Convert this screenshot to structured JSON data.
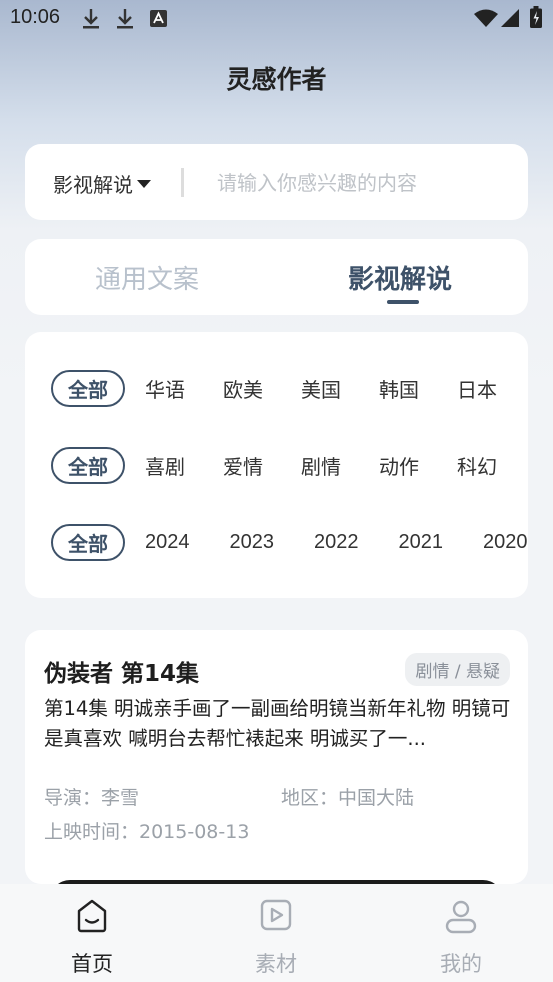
{
  "status_bar": {
    "time": "10:06"
  },
  "header": {
    "title": "灵感作者"
  },
  "search": {
    "category": "影视解说",
    "placeholder": "请输入你感兴趣的内容",
    "value": ""
  },
  "tabs": [
    {
      "label": "通用文案",
      "active": false
    },
    {
      "label": "影视解说",
      "active": true
    }
  ],
  "filters": {
    "regions": {
      "all_label": "全部",
      "options": [
        "华语",
        "欧美",
        "美国",
        "韩国",
        "日本"
      ]
    },
    "genres": {
      "all_label": "全部",
      "options": [
        "喜剧",
        "爱情",
        "剧情",
        "动作",
        "科幻"
      ]
    },
    "years": {
      "all_label": "全部",
      "options": [
        "2024",
        "2023",
        "2022",
        "2021",
        "2020"
      ]
    }
  },
  "item": {
    "title": "伪装者 第14集",
    "genre": "剧情 / 悬疑",
    "description": "第14集 明诚亲手画了一副画给明镜当新年礼物 明镜可是真喜欢 喊明台去帮忙裱起来 明诚买了一...",
    "director": "导演：李雪",
    "region": "地区：中国大陆",
    "release": "上映时间：2015-08-13"
  },
  "bottom_nav": [
    {
      "label": "首页",
      "icon": "home-icon",
      "active": true
    },
    {
      "label": "素材",
      "icon": "play-square-icon",
      "active": false
    },
    {
      "label": "我的",
      "icon": "profile-icon",
      "active": false
    }
  ],
  "colors": {
    "accent": "#3e5269",
    "inactive_tab": "#b8c1cc",
    "meta_text": "#9ba1a8",
    "nav_inactive": "#a8adb5"
  }
}
